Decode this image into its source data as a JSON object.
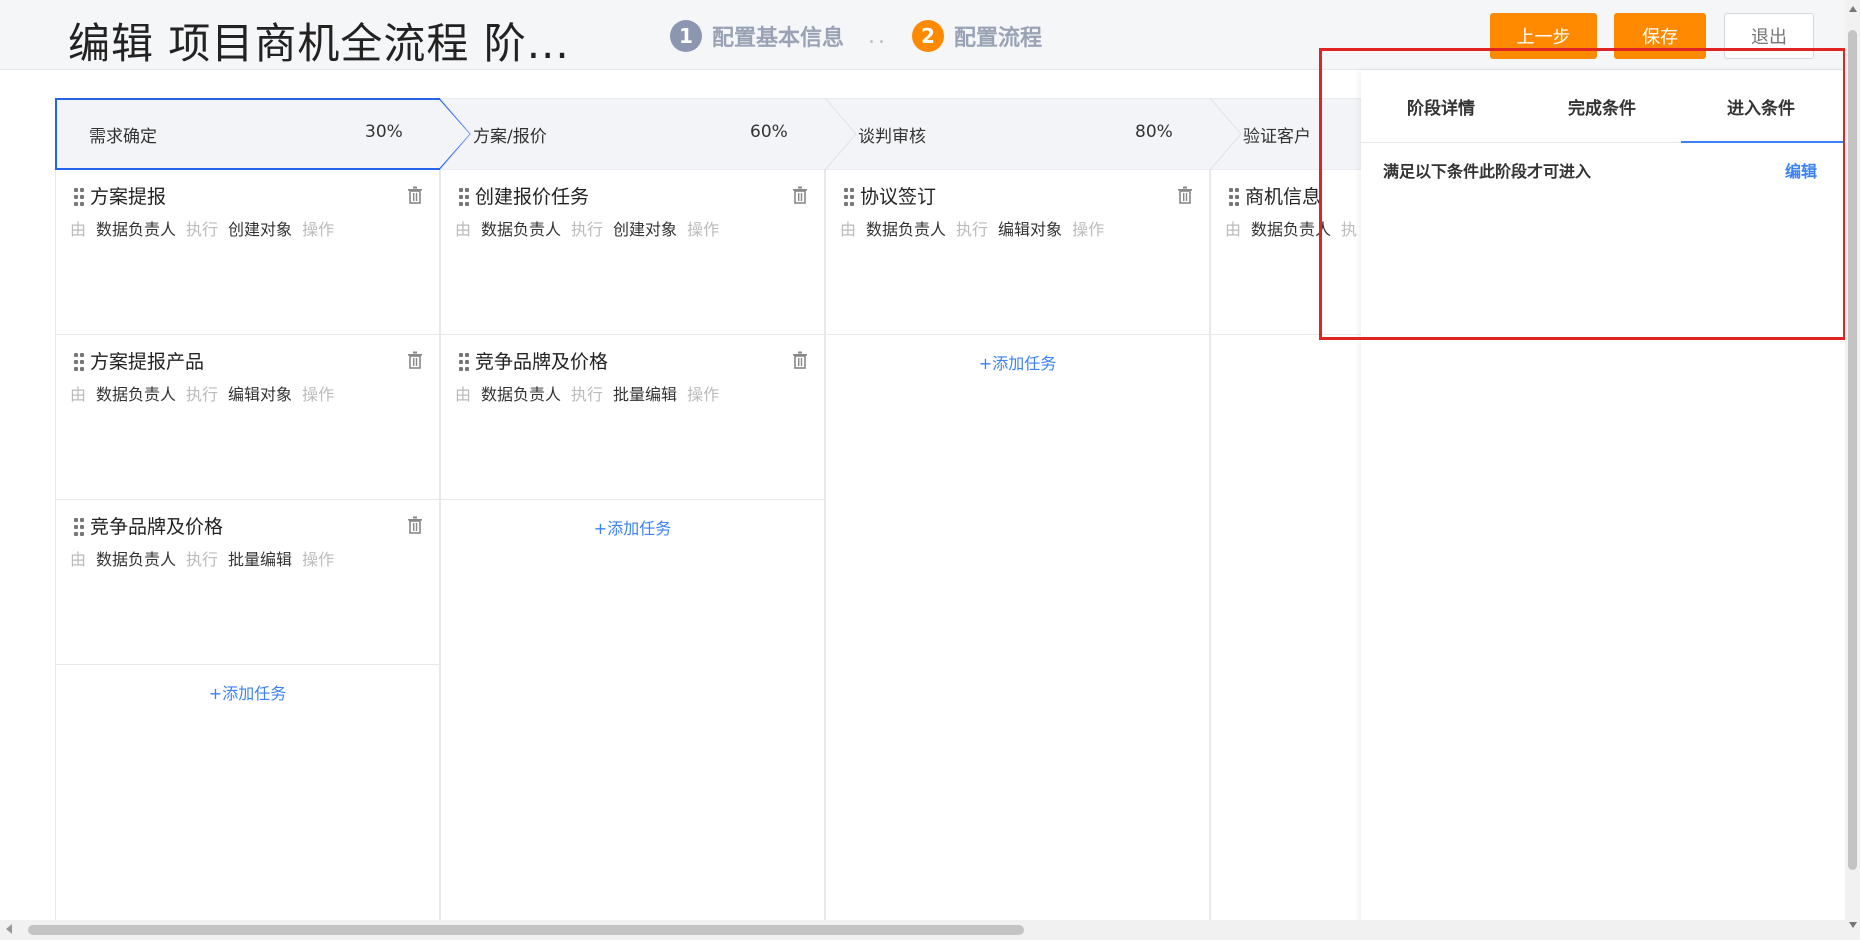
{
  "header": {
    "title": "编辑 项目商机全流程 阶...",
    "steps": [
      {
        "num": "1",
        "label": "配置基本信息",
        "color": "#8d96b0"
      },
      {
        "num": "2",
        "label": "配置流程",
        "color": "#ff8a00"
      }
    ],
    "step_separator": "..",
    "buttons": {
      "prev": "上一步",
      "save": "保存",
      "exit": "退出"
    }
  },
  "stages": [
    {
      "name": "需求确定",
      "percent": "30%",
      "active": true
    },
    {
      "name": "方案/报价",
      "percent": "60%",
      "active": false
    },
    {
      "name": "谈判审核",
      "percent": "80%",
      "active": false
    },
    {
      "name": "验证客户",
      "percent": "",
      "active": false
    }
  ],
  "columns": [
    {
      "tasks": [
        {
          "name": "方案提报",
          "by": "由",
          "owner": "数据负责人",
          "exec": "执行",
          "action": "创建对象",
          "op": "操作"
        },
        {
          "name": "方案提报产品",
          "by": "由",
          "owner": "数据负责人",
          "exec": "执行",
          "action": "编辑对象",
          "op": "操作"
        },
        {
          "name": "竞争品牌及价格",
          "by": "由",
          "owner": "数据负责人",
          "exec": "执行",
          "action": "批量编辑",
          "op": "操作"
        }
      ],
      "add_label": "+添加任务"
    },
    {
      "tasks": [
        {
          "name": "创建报价任务",
          "by": "由",
          "owner": "数据负责人",
          "exec": "执行",
          "action": "创建对象",
          "op": "操作"
        },
        {
          "name": "竞争品牌及价格",
          "by": "由",
          "owner": "数据负责人",
          "exec": "执行",
          "action": "批量编辑",
          "op": "操作"
        }
      ],
      "add_label": "+添加任务"
    },
    {
      "tasks": [
        {
          "name": "协议签订",
          "by": "由",
          "owner": "数据负责人",
          "exec": "执行",
          "action": "编辑对象",
          "op": "操作"
        }
      ],
      "add_label": "+添加任务"
    },
    {
      "tasks": [
        {
          "name": "商机信息",
          "by": "由",
          "owner": "数据负责人",
          "exec": "执",
          "action": "",
          "op": ""
        }
      ],
      "add_label": ""
    }
  ],
  "panel": {
    "tabs": [
      "阶段详情",
      "完成条件",
      "进入条件"
    ],
    "active_tab": "进入条件",
    "condition_text": "满足以下条件此阶段才可进入",
    "edit_label": "编辑"
  },
  "colors": {
    "accent": "#ff8a00",
    "link": "#3b82f6",
    "active_stage_border": "#2563eb",
    "highlight": "#e02424"
  }
}
